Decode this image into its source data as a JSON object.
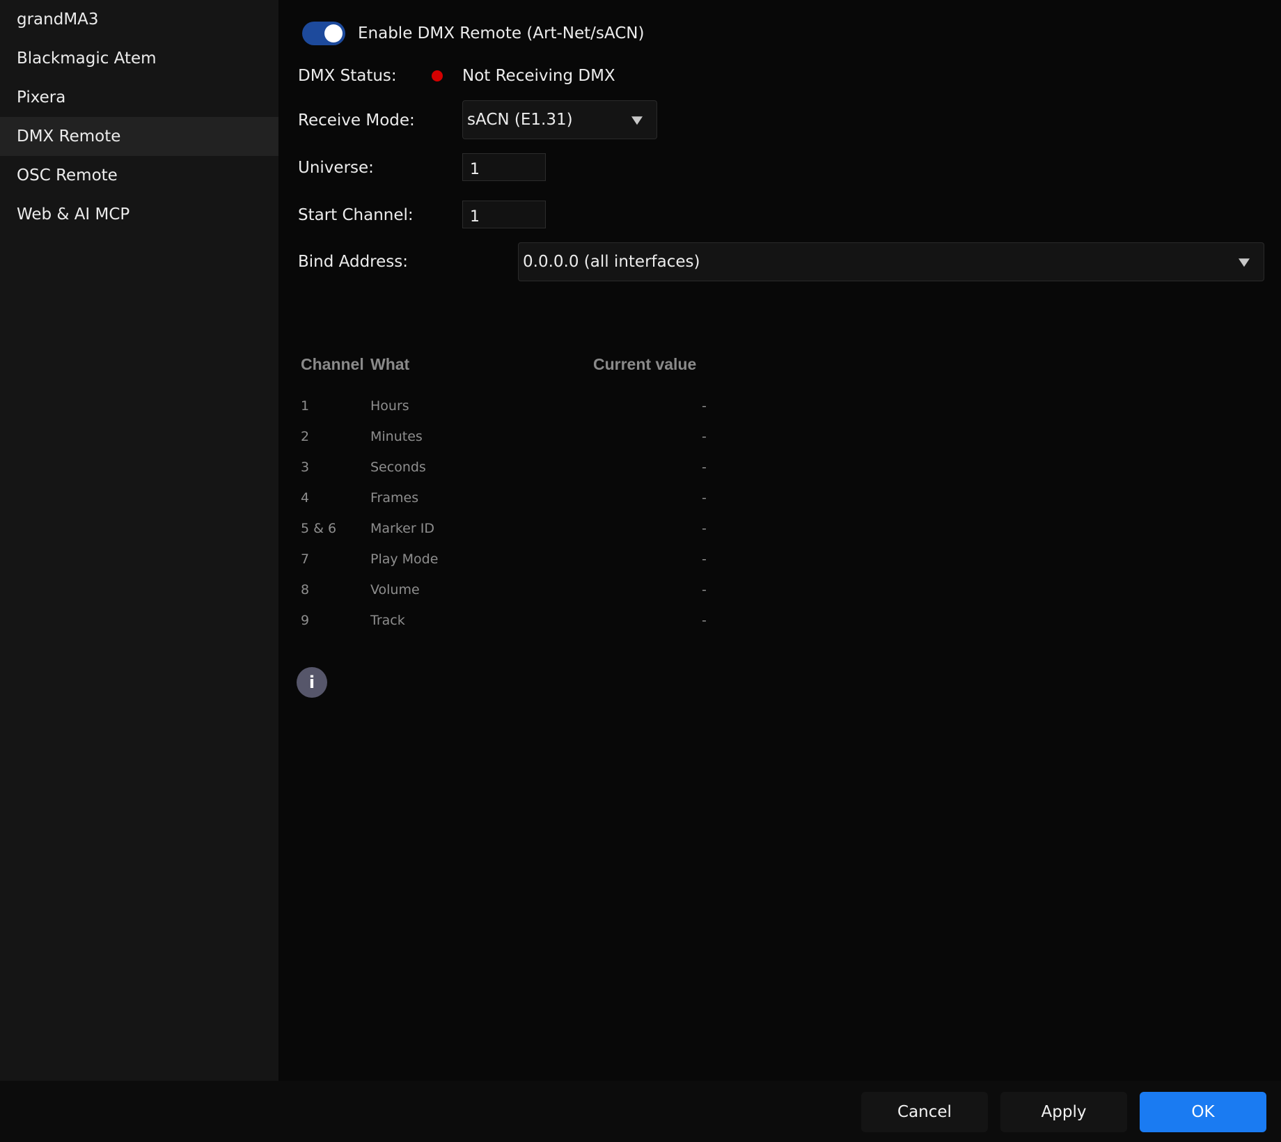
{
  "sidebar": {
    "items": [
      {
        "label": "grandMA3"
      },
      {
        "label": "Blackmagic Atem"
      },
      {
        "label": "Pixera"
      },
      {
        "label": "DMX Remote"
      },
      {
        "label": "OSC Remote"
      },
      {
        "label": "Web & AI MCP"
      }
    ],
    "active_index": 3
  },
  "main": {
    "enable_toggle": {
      "label": "Enable DMX Remote (Art-Net/sACN)",
      "checked": true
    },
    "dmx_status": {
      "label": "DMX Status:",
      "value": "Not Receiving DMX",
      "color": "#d30000"
    },
    "receive_mode": {
      "label": "Receive Mode:",
      "value": "sACN (E1.31)"
    },
    "universe": {
      "label": "Universe:",
      "value": "1"
    },
    "start_channel": {
      "label": "Start Channel:",
      "value": "1"
    },
    "bind_address": {
      "label": "Bind Address:",
      "value": "0.0.0.0 (all interfaces)"
    }
  },
  "table": {
    "headers": {
      "channel": "Channel",
      "what": "What",
      "current_value": "Current value"
    },
    "rows": [
      {
        "channel": "1",
        "what": "Hours",
        "value": "-"
      },
      {
        "channel": "2",
        "what": "Minutes",
        "value": "-"
      },
      {
        "channel": "3",
        "what": "Seconds",
        "value": "-"
      },
      {
        "channel": "4",
        "what": "Frames",
        "value": "-"
      },
      {
        "channel": "5 & 6",
        "what": "Marker ID",
        "value": "-"
      },
      {
        "channel": "7",
        "what": "Play Mode",
        "value": "-"
      },
      {
        "channel": "8",
        "what": "Volume",
        "value": "-"
      },
      {
        "channel": "9",
        "what": "Track",
        "value": "-"
      }
    ]
  },
  "info": {
    "label": "i"
  },
  "footer": {
    "cancel_label": "Cancel",
    "apply_label": "Apply",
    "ok_label": "OK",
    "accent_color": "#1a7bf2"
  }
}
